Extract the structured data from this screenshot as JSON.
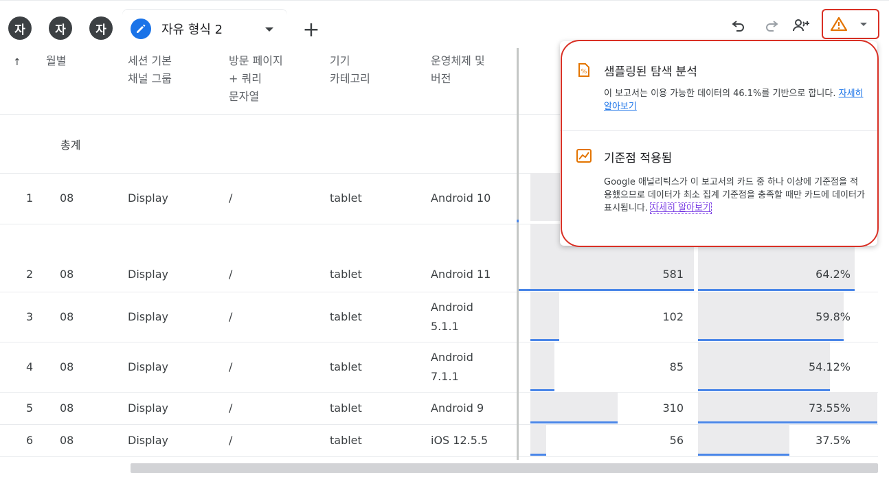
{
  "topbar": {
    "avatars": [
      "자",
      "자",
      "자"
    ],
    "tab": {
      "label": "자유 형식 2"
    },
    "add_tab": "+"
  },
  "colors": {
    "accent": "#1a73e8",
    "warning": "#e37400",
    "highlight": "#d93025",
    "bar_line": "#4a86e8"
  },
  "table": {
    "sort_arrow": "↑",
    "headers": [
      [
        "월별"
      ],
      [
        "세션 기본",
        "채널 그룹"
      ],
      [
        "방문 페이지",
        "+ 쿼리",
        "문자열"
      ],
      [
        "기기",
        "카테고리"
      ],
      [
        "운영체제 및",
        "버전"
      ]
    ],
    "total_label": "총계",
    "rows": [
      {
        "idx": "1",
        "month": "08",
        "channel": "Display",
        "page": "/",
        "device": "tablet",
        "os": [
          "Android 10"
        ],
        "v1": "",
        "v2": "",
        "bar1": null,
        "bar2": null
      },
      {
        "idx": "2",
        "month": "08",
        "channel": "Display",
        "page": "/",
        "device": "tablet",
        "os": [
          "Android 11"
        ],
        "v1": "581",
        "v2": "64.2%",
        "bar1": 1.0,
        "bar2": 0.642
      },
      {
        "idx": "3",
        "month": "08",
        "channel": "Display",
        "page": "/",
        "device": "tablet",
        "os": [
          "Android",
          "5.1.1"
        ],
        "v1": "102",
        "v2": "59.8%",
        "bar1": 0.176,
        "bar2": 0.598
      },
      {
        "idx": "4",
        "month": "08",
        "channel": "Display",
        "page": "/",
        "device": "tablet",
        "os": [
          "Android",
          "7.1.1"
        ],
        "v1": "85",
        "v2": "54.12%",
        "bar1": 0.146,
        "bar2": 0.5412
      },
      {
        "idx": "5",
        "month": "08",
        "channel": "Display",
        "page": "/",
        "device": "tablet",
        "os": [
          "Android 9"
        ],
        "v1": "310",
        "v2": "73.55%",
        "bar1": 0.534,
        "bar2": 0.7355
      },
      {
        "idx": "6",
        "month": "08",
        "channel": "Display",
        "page": "/",
        "device": "tablet",
        "os": [
          "iOS 12.5.5"
        ],
        "v1": "56",
        "v2": "37.5%",
        "bar1": 0.096,
        "bar2": 0.375
      }
    ]
  },
  "popup": {
    "sampling": {
      "title": "샘플링된 탐색 분석",
      "body": "이 보고서는 이용 가능한 데이터의 46.1%를 기반으로 합니다. ",
      "link": "자세히 알아보기"
    },
    "threshold": {
      "title": "기준점 적용됨",
      "body": "Google 애널리틱스가 이 보고서의 카드 중 하나 이상에 기준점을 적용했으므로 데이터가 최소 집계 기준점을 충족할 때만 카드에 데이터가 표시됩니다. ",
      "link": "자세히 알아보기"
    }
  }
}
